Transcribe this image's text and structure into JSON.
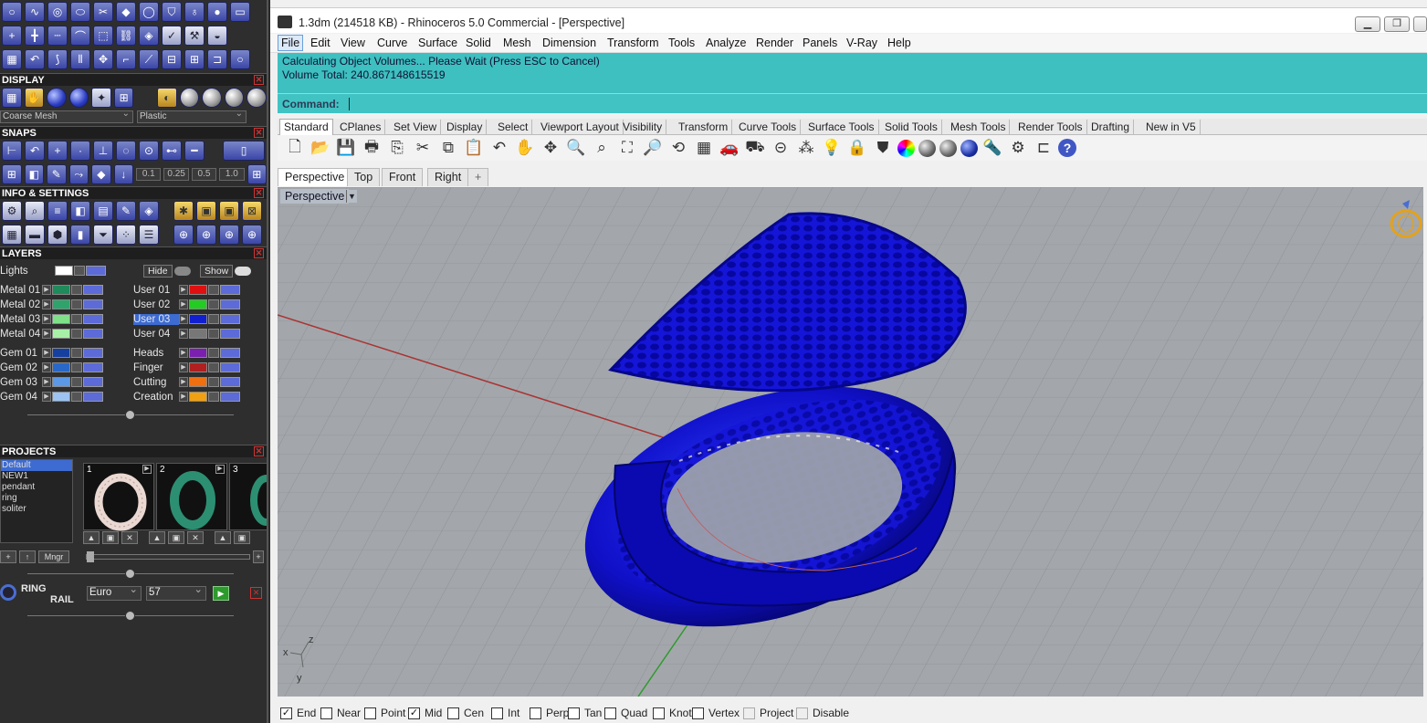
{
  "window": {
    "title": "1.3dm (214518 KB) - Rhinoceros 5.0 Commercial - [Perspective]"
  },
  "menu": [
    "File",
    "Edit",
    "View",
    "Curve",
    "Surface",
    "Solid",
    "Mesh",
    "Dimension",
    "Transform",
    "Tools",
    "Analyze",
    "Render",
    "Panels",
    "V-Ray",
    "Help"
  ],
  "command": {
    "line1": "Calculating Object Volumes... Please Wait (Press ESC to Cancel)",
    "line2": "Volume Total: 240.867148615519",
    "label": "Command:"
  },
  "toolbar_tabs": [
    "Standard",
    "CPlanes",
    "Set View",
    "Display",
    "Select",
    "Viewport Layout",
    "Visibility",
    "Transform",
    "Curve Tools",
    "Surface Tools",
    "Solid Tools",
    "Mesh Tools",
    "Render Tools",
    "Drafting",
    "New in V5"
  ],
  "viewport_tabs": [
    "Perspective",
    "Top",
    "Front",
    "Right",
    "+"
  ],
  "viewport": {
    "label": "Perspective",
    "axis_x": "x",
    "axis_y": "y",
    "axis_z": "z"
  },
  "osnaps": [
    {
      "label": "End",
      "checked": true
    },
    {
      "label": "Near",
      "checked": false
    },
    {
      "label": "Point",
      "checked": false
    },
    {
      "label": "Mid",
      "checked": true
    },
    {
      "label": "Cen",
      "checked": false
    },
    {
      "label": "Int",
      "checked": false
    },
    {
      "label": "Perp",
      "checked": false
    },
    {
      "label": "Tan",
      "checked": false
    },
    {
      "label": "Quad",
      "checked": false
    },
    {
      "label": "Knot",
      "checked": false
    },
    {
      "label": "Vertex",
      "checked": false
    },
    {
      "label": "Project",
      "checked": false
    },
    {
      "label": "Disable",
      "checked": false
    }
  ],
  "left_panel": {
    "display": {
      "title": "DISPLAY",
      "mesh_value": "Coarse Mesh",
      "material_value": "Plastic"
    },
    "snaps": {
      "title": "SNAPS",
      "values": [
        "0.1",
        "0.25",
        "0.5",
        "1.0"
      ]
    },
    "info": {
      "title": "INFO & SETTINGS"
    },
    "layers": {
      "title": "LAYERS",
      "lights": "Lights",
      "hide": "Hide",
      "show": "Show",
      "left": [
        {
          "name": "Metal 01",
          "color": "#1f8a5a"
        },
        {
          "name": "Metal 02",
          "color": "#2ea36b"
        },
        {
          "name": "Metal 03",
          "color": "#7fe08a"
        },
        {
          "name": "Metal 04",
          "color": "#a8f0a8"
        },
        {
          "name": "Gem 01",
          "color": "#1540a0"
        },
        {
          "name": "Gem 02",
          "color": "#2a68c8"
        },
        {
          "name": "Gem 03",
          "color": "#5b99e6"
        },
        {
          "name": "Gem 04",
          "color": "#9cc3f2"
        }
      ],
      "right": [
        {
          "name": "User 01",
          "color": "#e01010"
        },
        {
          "name": "User 02",
          "color": "#22cc22"
        },
        {
          "name": "User 03",
          "color": "#1020d0"
        },
        {
          "name": "User 04",
          "color": "#777777"
        },
        {
          "name": "Heads",
          "color": "#7a1fb0"
        },
        {
          "name": "Finger",
          "color": "#b02020"
        },
        {
          "name": "Cutting",
          "color": "#f07010"
        },
        {
          "name": "Creation",
          "color": "#f0a010"
        }
      ]
    },
    "projects": {
      "title": "PROJECTS",
      "items": [
        "Default",
        "NEW1",
        "pendant",
        "ring",
        "soliter"
      ],
      "thumbs": [
        "1",
        "2",
        "3"
      ],
      "mngr": "Mngr"
    },
    "ringrail": {
      "label1": "RING",
      "label2": "RAIL",
      "standard": "Euro",
      "size": "57"
    }
  }
}
